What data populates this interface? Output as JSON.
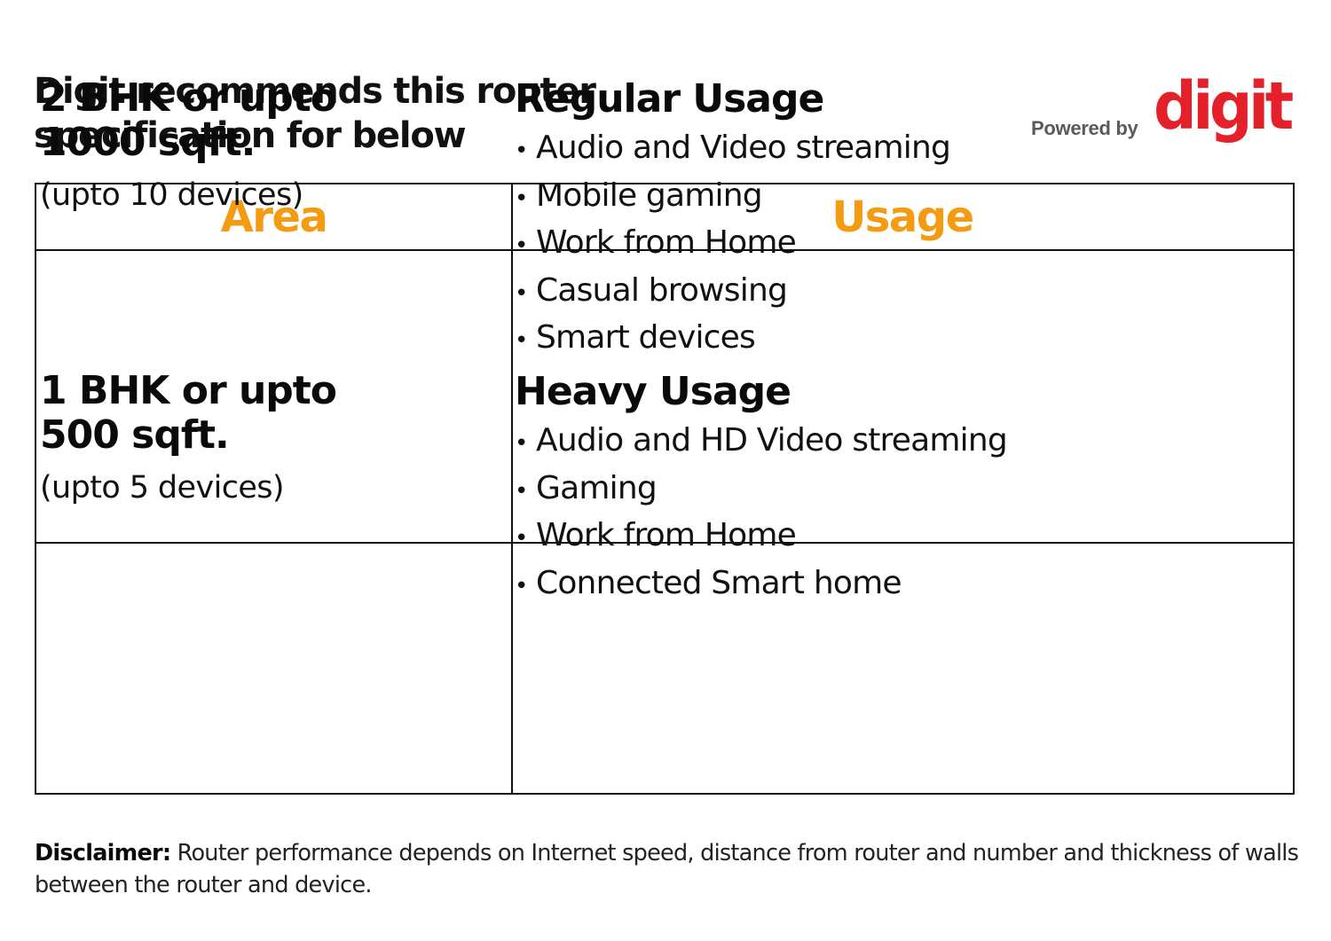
{
  "header": {
    "title_lines": [
      "Digit recommends this router",
      "specification for below"
    ],
    "powered_by": "Powered by",
    "brand_logo": "digit",
    "brand_color": "#e4202a"
  },
  "table": {
    "accent_color": "#f39c12",
    "columns": [
      "Area",
      "Usage"
    ],
    "rows": [
      {
        "area": {
          "title_lines": [
            "2 BHK or upto",
            "1000 sqft."
          ],
          "devices": "(upto 10 devices)"
        },
        "usage": {
          "title": "Regular Usage",
          "items": [
            "Audio and Video streaming",
            "Mobile gaming",
            "Work from Home",
            "Casual browsing",
            "Smart devices"
          ]
        }
      },
      {
        "area": {
          "title_lines": [
            "1 BHK or upto",
            "500 sqft."
          ],
          "devices": "(upto 5 devices)"
        },
        "usage": {
          "title": "Heavy Usage",
          "items": [
            "Audio and HD Video streaming",
            "Gaming",
            "Work from Home",
            "Connected Smart home"
          ]
        }
      }
    ],
    "bullet_glyph": "•"
  },
  "disclaimer": {
    "label": "Disclaimer:",
    "text": " Router performance depends on Internet speed, distance from router and number and thickness of walls between the router and device."
  }
}
